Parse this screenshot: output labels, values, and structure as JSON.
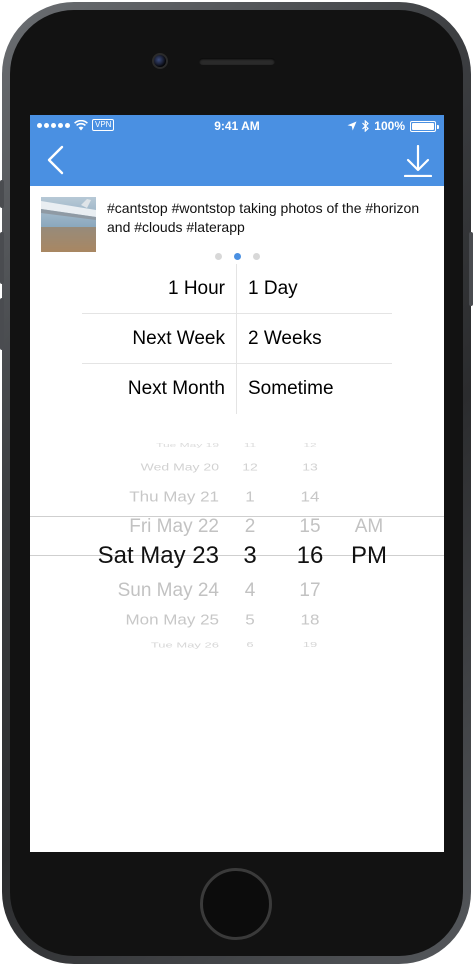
{
  "status_bar": {
    "carrier_badge": "VPN",
    "time": "9:41 AM",
    "battery": "100%"
  },
  "navbar": {
    "back_icon": "chevron-left-icon",
    "download_icon": "download-icon",
    "color": "#4a90e2"
  },
  "post": {
    "caption": "#cantstop #wontstop taking photos of the #horizon and #clouds #laterapp",
    "thumbnail_icon": "airplane-wing-photo"
  },
  "pager": {
    "count": 3,
    "active_index": 1
  },
  "quick_options": [
    {
      "left": "1 Hour",
      "right": "1 Day"
    },
    {
      "left": "Next Week",
      "right": "2 Weeks"
    },
    {
      "left": "Next Month",
      "right": "Sometime"
    }
  ],
  "picker": {
    "rows": [
      {
        "date": "Tue May 19",
        "hour": "11",
        "minute": "12",
        "ampm": ""
      },
      {
        "date": "Wed May 20",
        "hour": "12",
        "minute": "13",
        "ampm": ""
      },
      {
        "date": "Thu May 21",
        "hour": "1",
        "minute": "14",
        "ampm": ""
      },
      {
        "date": "Fri May 22",
        "hour": "2",
        "minute": "15",
        "ampm": "AM"
      },
      {
        "date": "Sat May 23",
        "hour": "3",
        "minute": "16",
        "ampm": "PM"
      },
      {
        "date": "Sun May 24",
        "hour": "4",
        "minute": "17",
        "ampm": ""
      },
      {
        "date": "Mon May 25",
        "hour": "5",
        "minute": "18",
        "ampm": ""
      },
      {
        "date": "Tue May 26",
        "hour": "6",
        "minute": "19",
        "ampm": ""
      }
    ],
    "selected": {
      "date": "Sat May 23",
      "hour": "3",
      "minute": "16",
      "ampm": "PM"
    }
  }
}
